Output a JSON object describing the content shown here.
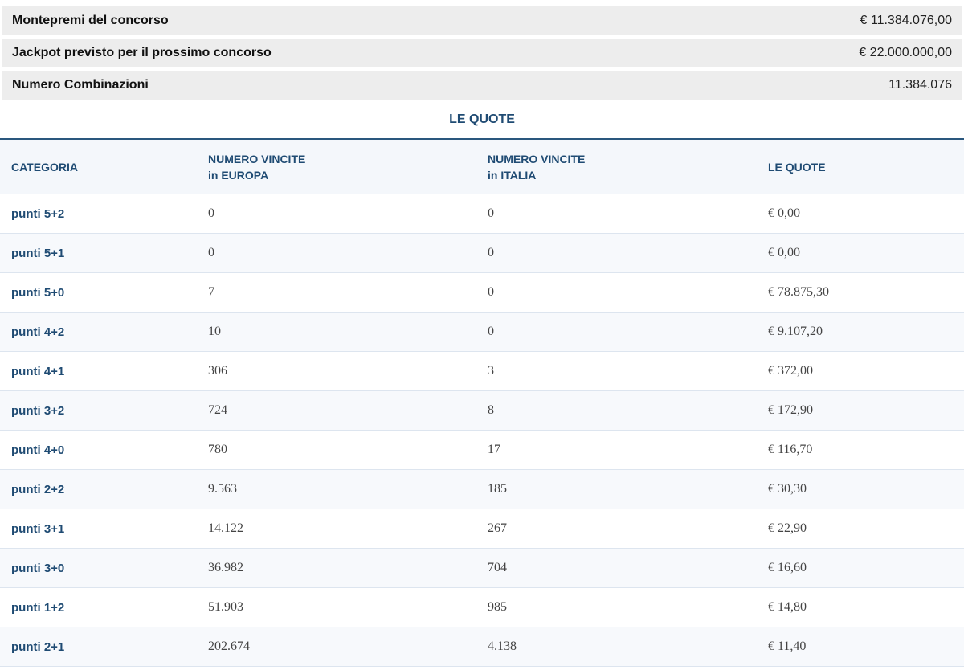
{
  "summary": [
    {
      "label": "Montepremi del concorso",
      "value": "€ 11.384.076,00"
    },
    {
      "label": "Jackpot previsto per il prossimo concorso",
      "value": "€ 22.000.000,00"
    },
    {
      "label": "Numero Combinazioni",
      "value": "11.384.076"
    }
  ],
  "quote_section": {
    "title": "LE QUOTE",
    "headers": {
      "categoria": "CATEGORIA",
      "europa_line1": "NUMERO VINCITE",
      "europa_line2": "in EUROPA",
      "italia_line1": "NUMERO VINCITE",
      "italia_line2": "in ITALIA",
      "quote": "LE QUOTE"
    },
    "rows": [
      {
        "categoria": "punti 5+2",
        "europa": "0",
        "italia": "0",
        "quota": "€ 0,00"
      },
      {
        "categoria": "punti 5+1",
        "europa": "0",
        "italia": "0",
        "quota": "€ 0,00"
      },
      {
        "categoria": "punti 5+0",
        "europa": "7",
        "italia": "0",
        "quota": "€ 78.875,30"
      },
      {
        "categoria": "punti 4+2",
        "europa": "10",
        "italia": "0",
        "quota": "€ 9.107,20"
      },
      {
        "categoria": "punti 4+1",
        "europa": "306",
        "italia": "3",
        "quota": "€ 372,00"
      },
      {
        "categoria": "punti 3+2",
        "europa": "724",
        "italia": "8",
        "quota": "€ 172,90"
      },
      {
        "categoria": "punti 4+0",
        "europa": "780",
        "italia": "17",
        "quota": "€ 116,70"
      },
      {
        "categoria": "punti 2+2",
        "europa": "9.563",
        "italia": "185",
        "quota": "€ 30,30"
      },
      {
        "categoria": "punti 3+1",
        "europa": "14.122",
        "italia": "267",
        "quota": "€ 22,90"
      },
      {
        "categoria": "punti 3+0",
        "europa": "36.982",
        "italia": "704",
        "quota": "€ 16,60"
      },
      {
        "categoria": "punti 1+2",
        "europa": "51.903",
        "italia": "985",
        "quota": "€ 14,80"
      },
      {
        "categoria": "punti 2+1",
        "europa": "202.674",
        "italia": "4.138",
        "quota": "€ 11,40"
      }
    ]
  }
}
